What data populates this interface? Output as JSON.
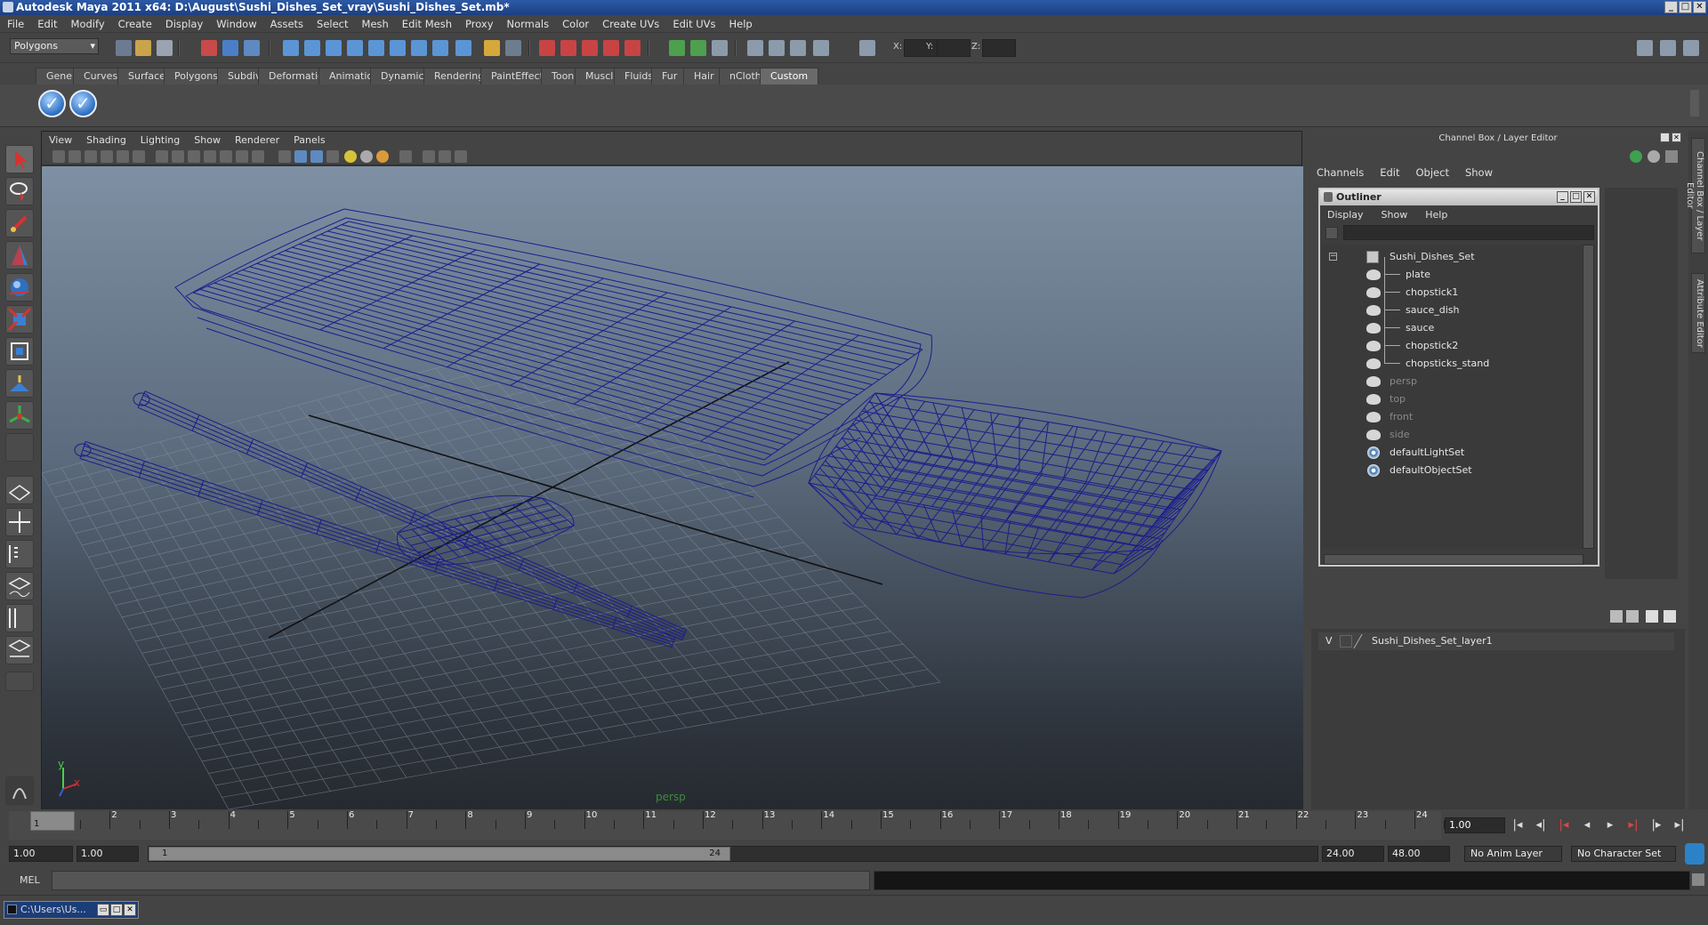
{
  "window": {
    "title": "Autodesk Maya 2011 x64: D:\\August\\Sushi_Dishes_Set_vray\\Sushi_Dishes_Set.mb*"
  },
  "menubar": [
    "File",
    "Edit",
    "Modify",
    "Create",
    "Display",
    "Window",
    "Assets",
    "Select",
    "Mesh",
    "Edit Mesh",
    "Proxy",
    "Normals",
    "Color",
    "Create UVs",
    "Edit UVs",
    "Help"
  ],
  "statusline": {
    "mode": "Polygons",
    "x_label": "X:",
    "y_label": "Y:",
    "z_label": "Z:"
  },
  "shelf": {
    "tabs": [
      "General",
      "Curves",
      "Surfaces",
      "Polygons",
      "Subdivs",
      "Deformation",
      "Animation",
      "Dynamics",
      "Rendering",
      "PaintEffects",
      "Toon",
      "Muscle",
      "Fluids",
      "Fur",
      "Hair",
      "nCloth",
      "Custom"
    ],
    "active_tab": "Custom"
  },
  "viewport": {
    "menu": [
      "View",
      "Shading",
      "Lighting",
      "Show",
      "Renderer",
      "Panels"
    ],
    "camera_label": "persp",
    "axis_y": "y",
    "axis_x": "x",
    "wire_color": "#1c1c8c"
  },
  "channelbox": {
    "title": "Channel Box / Layer Editor",
    "menu": [
      "Channels",
      "Edit",
      "Object",
      "Show"
    ]
  },
  "outliner": {
    "title": "Outliner",
    "menu": [
      "Display",
      "Show",
      "Help"
    ],
    "items": [
      {
        "label": "Sushi_Dishes_Set",
        "dim": false
      },
      {
        "label": "plate",
        "dim": false
      },
      {
        "label": "chopstick1",
        "dim": false
      },
      {
        "label": "sauce_dish",
        "dim": false
      },
      {
        "label": "sauce",
        "dim": false
      },
      {
        "label": "chopstick2",
        "dim": false
      },
      {
        "label": "chopsticks_stand",
        "dim": false
      },
      {
        "label": "persp",
        "dim": true
      },
      {
        "label": "top",
        "dim": true
      },
      {
        "label": "front",
        "dim": true
      },
      {
        "label": "side",
        "dim": true
      },
      {
        "label": "defaultLightSet",
        "dim": false
      },
      {
        "label": "defaultObjectSet",
        "dim": false
      }
    ]
  },
  "layers": {
    "visible_flag": "V",
    "layer_name": "Sushi_Dishes_Set_layer1"
  },
  "side_tabs": [
    "Channel Box / Layer Editor",
    "Attribute Editor"
  ],
  "timeslider": {
    "ticks": [
      "1",
      "2",
      "3",
      "4",
      "5",
      "6",
      "7",
      "8",
      "9",
      "10",
      "11",
      "12",
      "13",
      "14",
      "15",
      "16",
      "17",
      "18",
      "19",
      "20",
      "21",
      "22",
      "23",
      "24"
    ],
    "current_frame_marker": "1",
    "current_time": "1.00"
  },
  "range": {
    "start_time": "1.00",
    "playback_start": "1.00",
    "handle_start": "1",
    "handle_end": "24",
    "playback_end": "24.00",
    "end_time": "48.00",
    "anim_layer": "No Anim Layer",
    "character_set": "No Character Set"
  },
  "commandline": {
    "label": "MEL"
  },
  "taskbar": {
    "item": "C:\\Users\\Us..."
  }
}
